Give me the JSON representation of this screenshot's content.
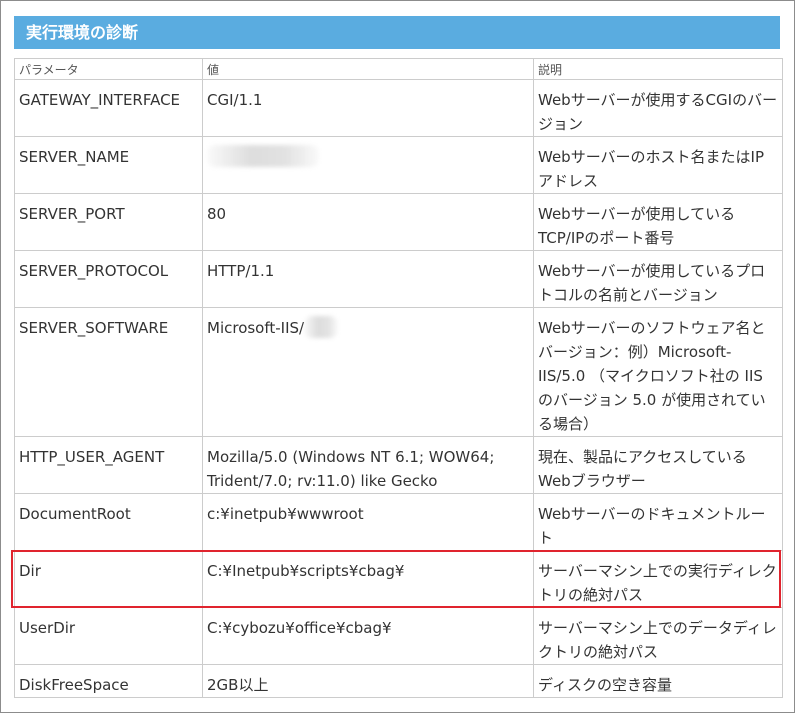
{
  "title": "実行環境の診断",
  "headers": {
    "param": "パラメータ",
    "value": "値",
    "desc": "説明"
  },
  "rows": [
    {
      "param": "GATEWAY_INTERFACE",
      "value": "CGI/1.1",
      "desc": "Webサーバーが使用するCGIのバージョン"
    },
    {
      "param": "SERVER_NAME",
      "value": "",
      "desc": "Webサーバーのホスト名またはIPアドレス"
    },
    {
      "param": "SERVER_PORT",
      "value": "80",
      "desc": "Webサーバーが使用しているTCP/IPのポート番号"
    },
    {
      "param": "SERVER_PROTOCOL",
      "value": "HTTP/1.1",
      "desc": "Webサーバーが使用しているプロトコルの名前とバージョン"
    },
    {
      "param": "SERVER_SOFTWARE",
      "value": "Microsoft-IIS/",
      "desc": "Webサーバーのソフトウェア名とバージョン：例）Microsoft-IIS/5.0 （マイクロソフト社の IIS のバージョン 5.0 が使用されている場合）"
    },
    {
      "param": "HTTP_USER_AGENT",
      "value": "Mozilla/5.0 (Windows NT 6.1; WOW64; Trident/7.0; rv:11.0) like Gecko",
      "desc": "現在、製品にアクセスしているWebブラウザー"
    },
    {
      "param": "DocumentRoot",
      "value": "c:¥inetpub¥wwwroot",
      "desc": "Webサーバーのドキュメントルート"
    },
    {
      "param": "Dir",
      "value": "C:¥Inetpub¥scripts¥cbag¥",
      "desc": "サーバーマシン上での実行ディレクトリの絶対パス"
    },
    {
      "param": "UserDir",
      "value": "C:¥cybozu¥office¥cbag¥",
      "desc": "サーバーマシン上でのデータディレクトリの絶対パス"
    },
    {
      "param": "DiskFreeSpace",
      "value": "2GB以上",
      "desc": "ディスクの空き容量"
    }
  ]
}
